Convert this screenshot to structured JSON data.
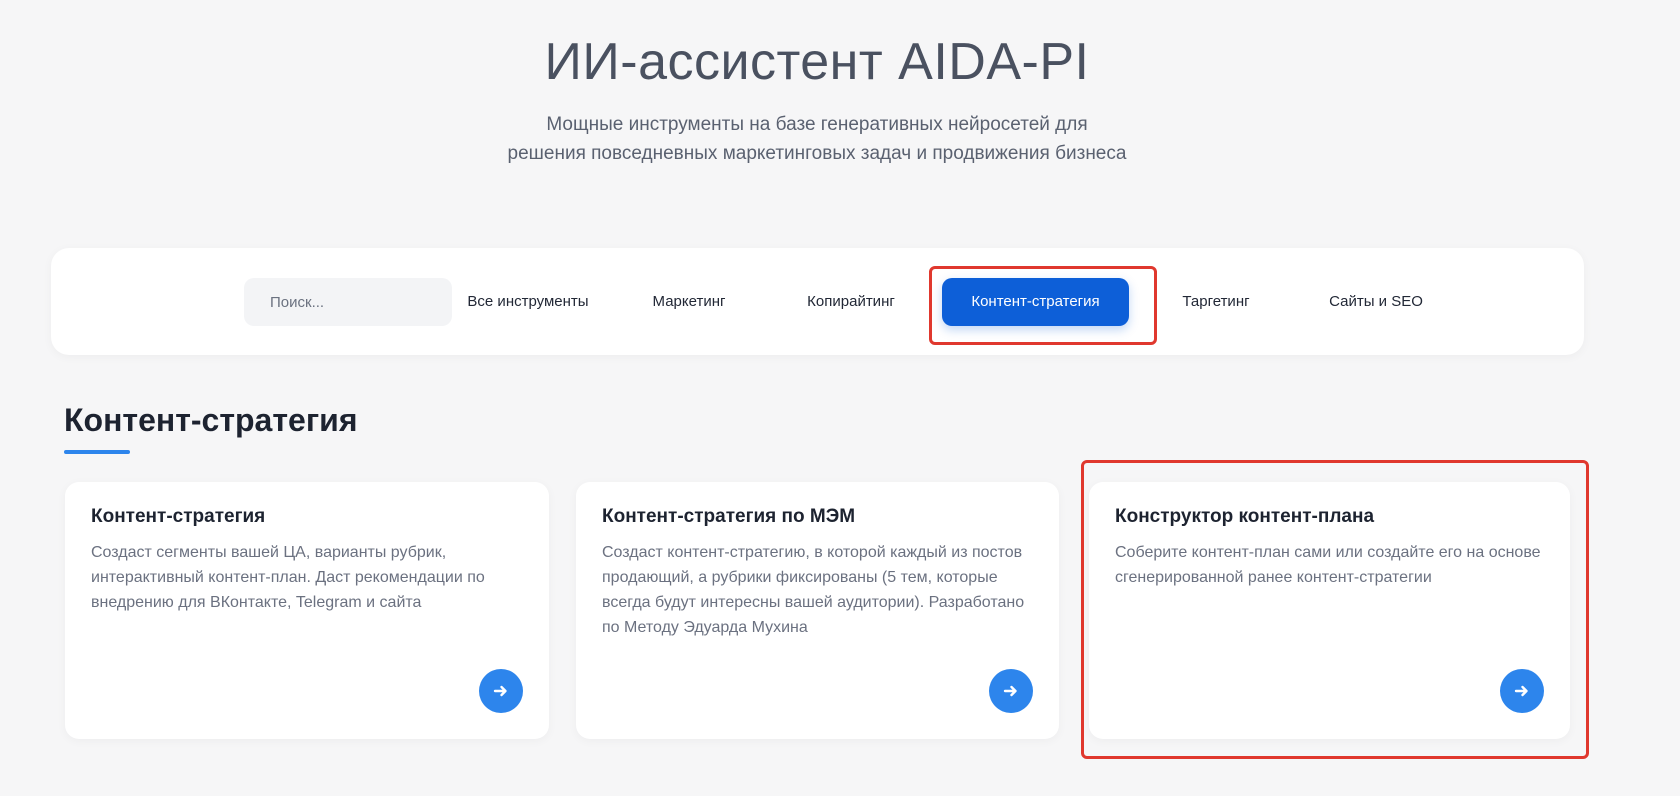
{
  "hero": {
    "title": "ИИ-ассистент AIDA-PI",
    "subtitle_line1": "Мощные инструменты на базе генеративных нейросетей для",
    "subtitle_line2": "решения повседневных маркетинговых задач и продвижения бизнеса"
  },
  "filters": {
    "search_placeholder": "Поиск...",
    "search_value": "",
    "tabs": [
      {
        "label": "Все инструменты",
        "active": false
      },
      {
        "label": "Маркетинг",
        "active": false
      },
      {
        "label": "Копирайтинг",
        "active": false
      },
      {
        "label": "Контент-стратегия",
        "active": true
      },
      {
        "label": "Таргетинг",
        "active": false
      },
      {
        "label": "Сайты и SEO",
        "active": false
      }
    ]
  },
  "section": {
    "title": "Контент-стратегия"
  },
  "cards": [
    {
      "title": "Контент-стратегия",
      "description": "Создаст сегменты вашей ЦА, варианты рубрик, интерактивный контент-план. Даст рекомендации по внедрению для ВКонтакте, Telegram и сайта",
      "icon": "arrow-right-icon"
    },
    {
      "title": "Контент-стратегия по МЭМ",
      "description": "Создаст контент-стратегию, в которой каждый из постов продающий, а рубрики фиксированы (5 тем, которые всегда будут интересны вашей аудитории). Разработано по Методу Эдуарда Мухина",
      "icon": "arrow-right-icon"
    },
    {
      "title": "Конструктор контент-плана",
      "description": "Соберите контент-план сами или создайте его на основе сгенерированной ранее контент-стратегии",
      "icon": "arrow-right-icon"
    }
  ],
  "colors": {
    "accent": "#0d5fd8",
    "arrow_button": "#2d85ec",
    "highlight": "#e0382e",
    "background": "#f6f6f7"
  }
}
